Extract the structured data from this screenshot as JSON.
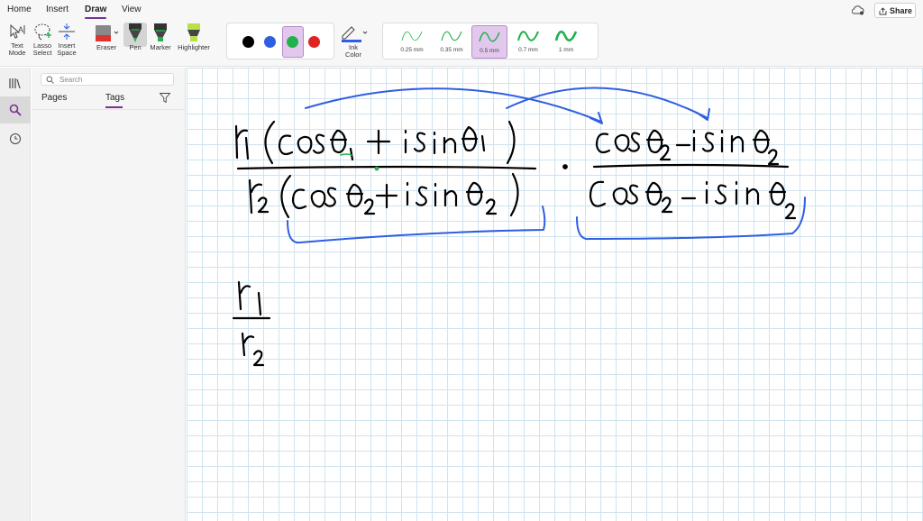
{
  "menu": {
    "items": [
      "Home",
      "Insert",
      "Draw",
      "View"
    ],
    "active": "Draw",
    "share_label": "Share"
  },
  "ribbon": {
    "text_mode": "Text\nMode",
    "lasso_select": "Lasso\nSelect",
    "insert_space": "Insert\nSpace",
    "eraser": "Eraser",
    "pen": "Pen",
    "marker": "Marker",
    "highlighter": "Highlighter",
    "ink_color": "Ink\nColor",
    "colors": [
      "#000000",
      "#2f5fe0",
      "#22b14c",
      "#e02424"
    ],
    "selected_color": "#22b14c",
    "sizes": [
      "0.25 mm",
      "0.35 mm",
      "0.5 mm",
      "0.7 mm",
      "1 mm"
    ],
    "selected_size": "0.5 mm",
    "accent": "#7a2f93"
  },
  "panel": {
    "search_placeholder": "Search",
    "tabs": [
      "Pages",
      "Tags"
    ],
    "active_tab": "Tags"
  },
  "canvas": {
    "content": "handwritten math: r1(cos θ1 + i sin θ1) / r2(cos θ2 + i sin θ2) · (cos θ2 − i sin θ2)/(cos θ2 − i sin θ2);  r1 / r2",
    "ink_colors": {
      "black": "#000000",
      "blue": "#2f5fe0",
      "green": "#22b14c"
    }
  }
}
